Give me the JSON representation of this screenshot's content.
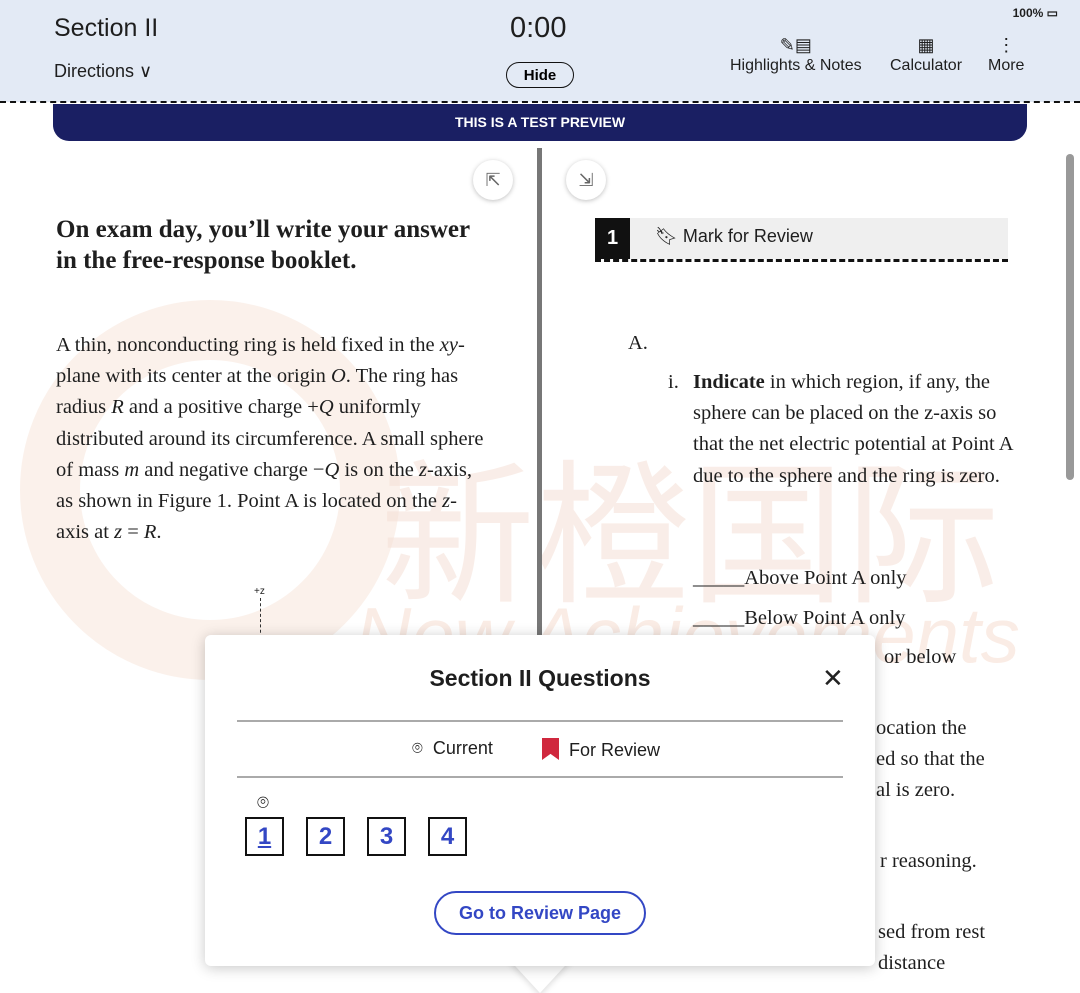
{
  "header": {
    "section": "Section II",
    "directions": "Directions",
    "timer": "0:00",
    "hide": "Hide",
    "battery": "100%",
    "tools": [
      {
        "label": "Highlights & Notes",
        "icon": "highlighter-notes-icon"
      },
      {
        "label": "Calculator",
        "icon": "calculator-icon"
      },
      {
        "label": "More",
        "icon": "more-vertical-icon"
      }
    ]
  },
  "banner": "THIS IS A TEST PREVIEW",
  "left": {
    "heading": "On exam day, you’ll write your answer in the free-response booklet.",
    "figure_label": "+z"
  },
  "right": {
    "question_number": "1",
    "mark_for_review": "Mark for Review",
    "part": "A.",
    "item_i_num": "i.",
    "item_i_bold": "Indicate",
    "item_i_text": " in which region, if any, the sphere can be placed on the z-axis so that the net electric potential at Point A due to the sphere and the ring is zero.",
    "options": [
      "Above Point A only",
      "Below Point A only"
    ],
    "blank": "_____",
    "fragments": [
      "or below",
      "ocation the",
      "ed so that the",
      "al is zero.",
      "r reasoning.",
      "sed from rest",
      "distance"
    ]
  },
  "watermark": {
    "cn": "新橙国际",
    "en": "New Achievements"
  },
  "popup": {
    "title": "Section II Questions",
    "legend_current": "Current",
    "legend_review": "For Review",
    "questions": [
      "1",
      "2",
      "3",
      "4"
    ],
    "current": 1,
    "go_review": "Go to Review Page",
    "review_color": "#d0283e",
    "accent": "#3347c4"
  }
}
